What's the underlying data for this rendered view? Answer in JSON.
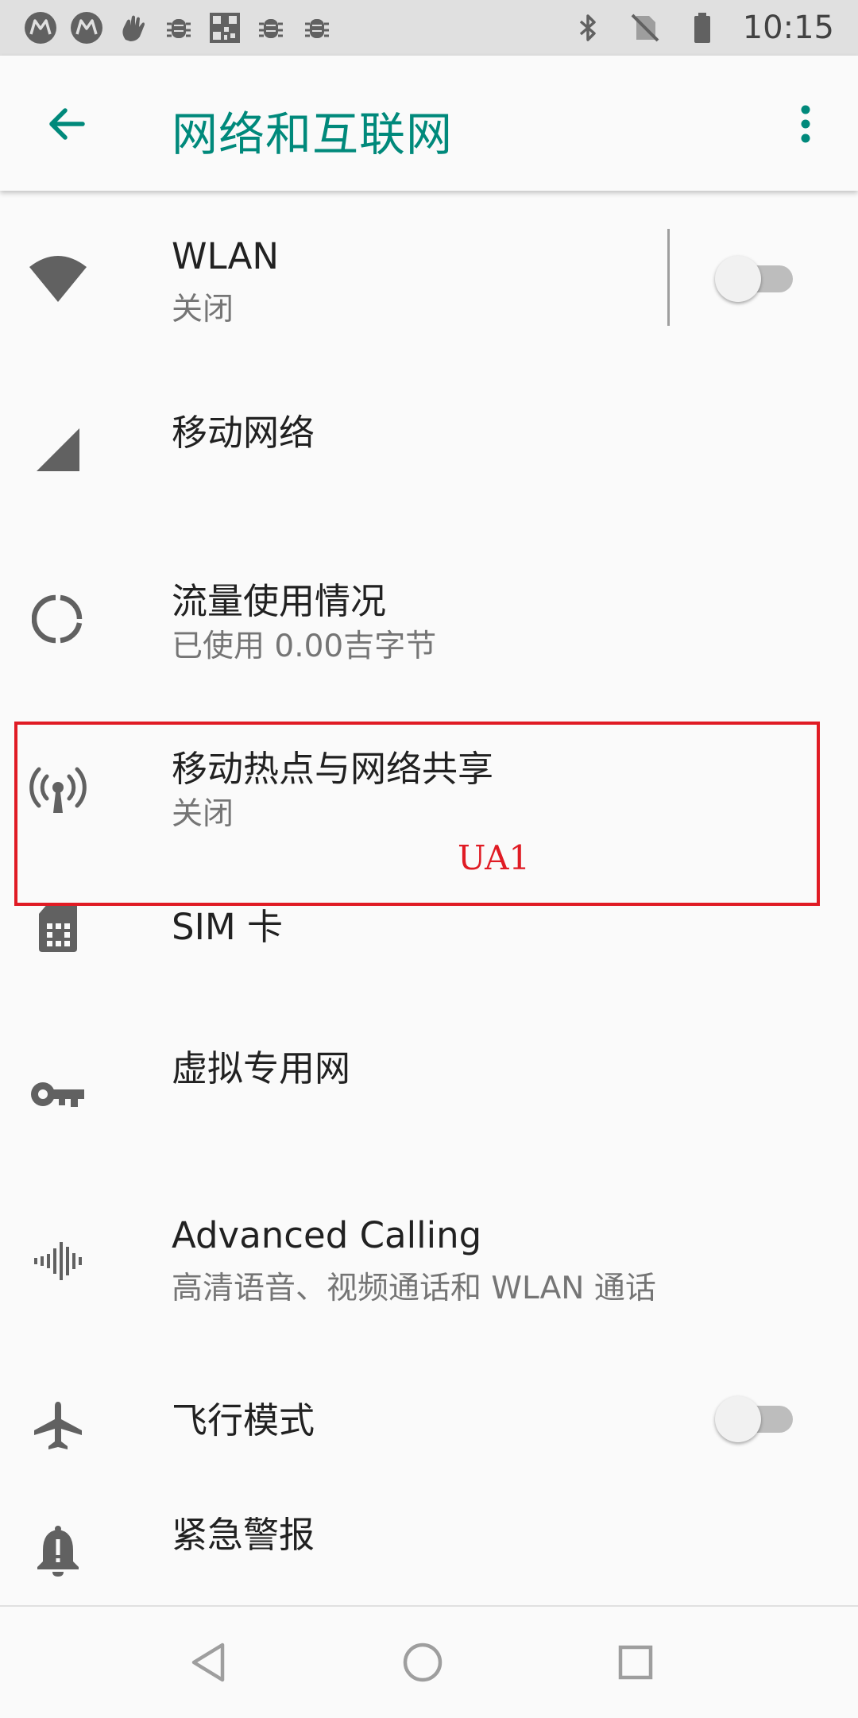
{
  "status_bar": {
    "time": "10:15",
    "left_icons": [
      "motorola-icon",
      "motorola-icon",
      "hand-wave-icon",
      "bug-icon",
      "qr-code-icon",
      "bug-icon",
      "bug-icon"
    ],
    "right_icons": [
      "bluetooth-icon",
      "no-sim-icon",
      "battery-icon"
    ]
  },
  "app_bar": {
    "title": "网络和互联网",
    "accent_color": "#00897b"
  },
  "items": [
    {
      "icon": "wifi-icon",
      "title": "WLAN",
      "subtitle": "关闭",
      "toggle": "off"
    },
    {
      "icon": "cellular-signal-icon",
      "title": "移动网络"
    },
    {
      "icon": "data-usage-icon",
      "title": "流量使用情况",
      "subtitle": "已使用 0.00吉字节"
    },
    {
      "icon": "hotspot-icon",
      "title": "移动热点与网络共享",
      "subtitle": "关闭"
    },
    {
      "icon": "sim-card-icon",
      "title": "SIM 卡"
    },
    {
      "icon": "vpn-key-icon",
      "title": "虚拟专用网"
    },
    {
      "icon": "waveform-icon",
      "title": "Advanced Calling",
      "subtitle": "高清语音、视频通话和 WLAN 通话"
    },
    {
      "icon": "airplane-icon",
      "title": "飞行模式",
      "toggle": "off"
    },
    {
      "icon": "alert-bell-icon",
      "title": "紧急警报"
    }
  ],
  "annotation": {
    "label": "UA1",
    "color": "#e01b24"
  },
  "nav_bar": [
    "back-icon",
    "home-icon",
    "recents-icon"
  ]
}
